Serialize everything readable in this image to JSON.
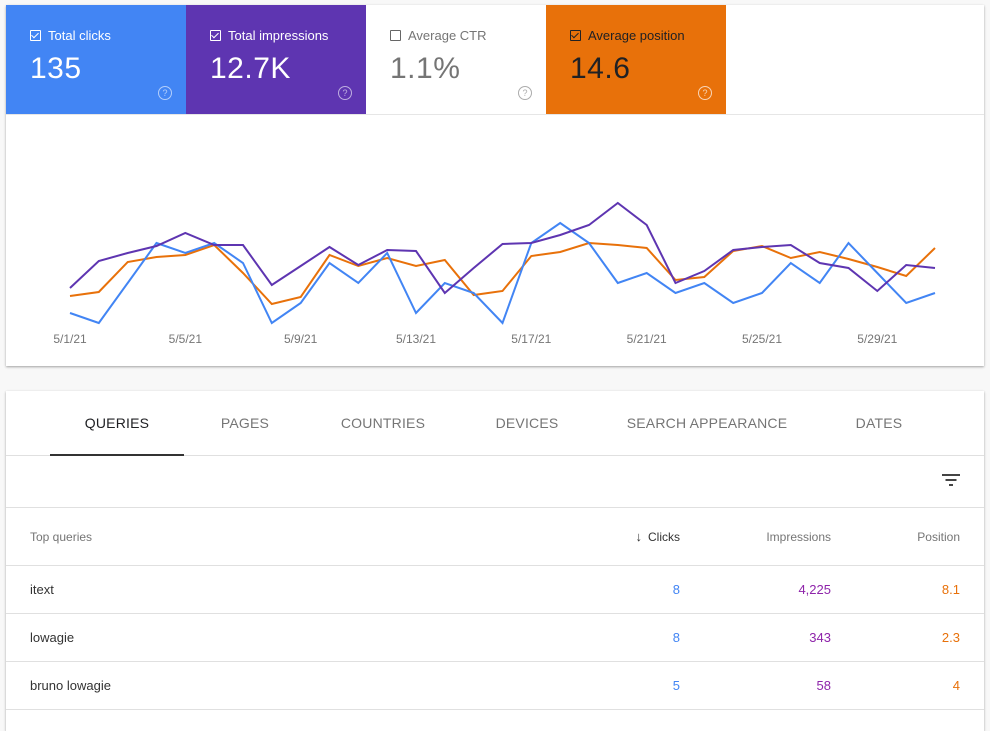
{
  "metrics": [
    {
      "id": "clicks",
      "label": "Total clicks",
      "value": "135",
      "checked": true,
      "color": "#4285f4"
    },
    {
      "id": "impressions",
      "label": "Total impressions",
      "value": "12.7K",
      "checked": true,
      "color": "#5e35b1"
    },
    {
      "id": "ctr",
      "label": "Average CTR",
      "value": "1.1%",
      "checked": false,
      "color": "#ffffff"
    },
    {
      "id": "position",
      "label": "Average position",
      "value": "14.6",
      "checked": true,
      "color": "#e8710a"
    }
  ],
  "help_glyph": "?",
  "chart_data": {
    "type": "line",
    "title": "",
    "xlabel": "",
    "ylabel": "",
    "x": [
      "5/1/21",
      "5/2/21",
      "5/3/21",
      "5/4/21",
      "5/5/21",
      "5/6/21",
      "5/7/21",
      "5/8/21",
      "5/9/21",
      "5/10/21",
      "5/11/21",
      "5/12/21",
      "5/13/21",
      "5/14/21",
      "5/15/21",
      "5/16/21",
      "5/17/21",
      "5/18/21",
      "5/19/21",
      "5/20/21",
      "5/21/21",
      "5/22/21",
      "5/23/21",
      "5/24/21",
      "5/25/21",
      "5/26/21",
      "5/27/21",
      "5/28/21",
      "5/29/21",
      "5/30/21",
      "5/31/21"
    ],
    "tick_labels": [
      "5/1/21",
      "5/5/21",
      "5/9/21",
      "5/13/21",
      "5/17/21",
      "5/21/21",
      "5/25/21",
      "5/29/21"
    ],
    "tick_indices": [
      0,
      4,
      8,
      12,
      16,
      20,
      24,
      28
    ],
    "y_scale": "relative (each series independently scaled, no axis shown)",
    "ylim": [
      0,
      100
    ],
    "grid": false,
    "series": [
      {
        "name": "Clicks",
        "color": "#4285f4",
        "values": [
          22,
          12,
          52,
          92,
          82,
          92,
          72,
          12,
          32,
          72,
          52,
          82,
          22,
          52,
          42,
          12,
          92,
          112,
          92,
          52,
          62,
          42,
          52,
          32,
          42,
          72,
          52,
          92,
          62,
          32,
          42
        ]
      },
      {
        "name": "Impressions",
        "color": "#5e35b1",
        "values": [
          47,
          74,
          82,
          89,
          102,
          90,
          90,
          50,
          69,
          88,
          70,
          85,
          84,
          42,
          67,
          91,
          92,
          100,
          110,
          132,
          110,
          52,
          64,
          85,
          88,
          90,
          72,
          67,
          44,
          70,
          67
        ]
      },
      {
        "name": "Position",
        "color": "#e8710a",
        "values": [
          39,
          43,
          73,
          78,
          80,
          90,
          62,
          31,
          38,
          80,
          69,
          77,
          69,
          75,
          40,
          44,
          79,
          83,
          92,
          90,
          87,
          55,
          58,
          84,
          89,
          77,
          83,
          76,
          68,
          59,
          87
        ]
      }
    ]
  },
  "tabs": [
    {
      "label": "QUERIES",
      "active": true
    },
    {
      "label": "PAGES",
      "active": false
    },
    {
      "label": "COUNTRIES",
      "active": false
    },
    {
      "label": "DEVICES",
      "active": false
    },
    {
      "label": "SEARCH APPEARANCE",
      "active": false
    },
    {
      "label": "DATES",
      "active": false
    }
  ],
  "table": {
    "columns": {
      "query": "Top queries",
      "clicks": "Clicks",
      "impressions": "Impressions",
      "position": "Position"
    },
    "sort_icon": "↓",
    "rows": [
      {
        "query": "itext",
        "clicks": "8",
        "impressions": "4,225",
        "position": "8.1"
      },
      {
        "query": "lowagie",
        "clicks": "8",
        "impressions": "343",
        "position": "2.3"
      },
      {
        "query": "bruno lowagie",
        "clicks": "5",
        "impressions": "58",
        "position": "4"
      }
    ]
  }
}
